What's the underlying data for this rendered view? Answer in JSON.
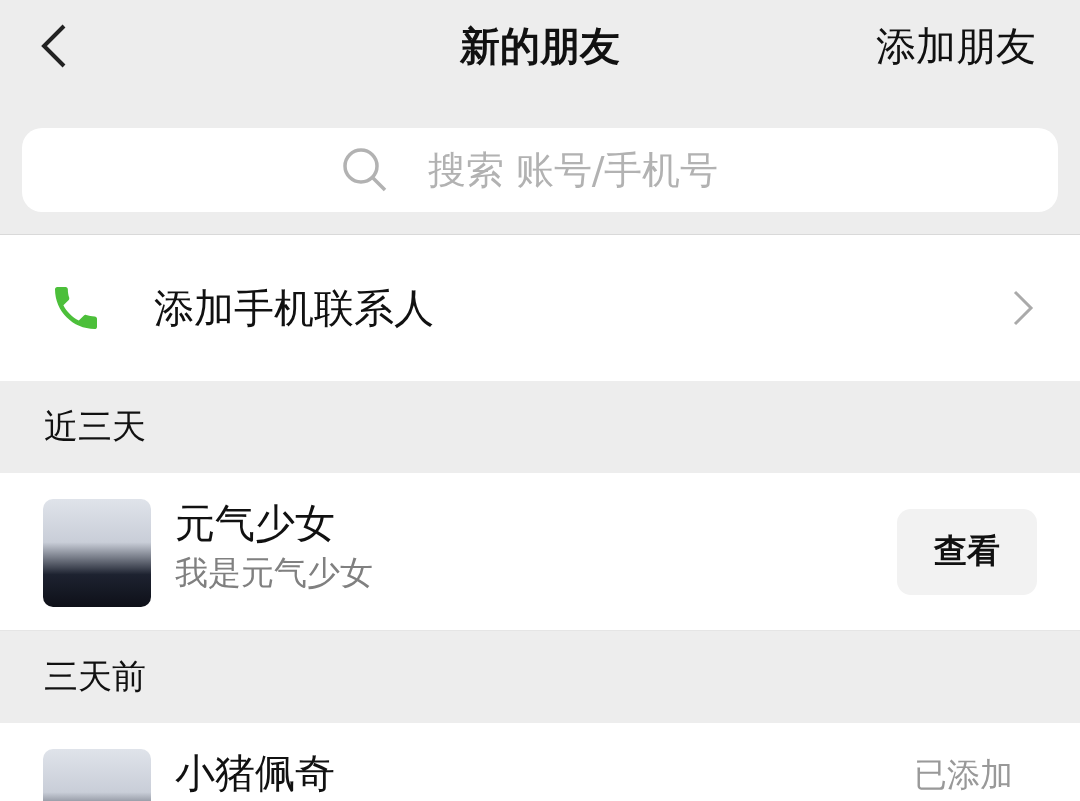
{
  "header": {
    "title": "新的朋友",
    "action": "添加朋友"
  },
  "search": {
    "placeholder": "搜索 账号/手机号"
  },
  "add_contacts": {
    "label": "添加手机联系人"
  },
  "sections": [
    {
      "title": "近三天",
      "requests": [
        {
          "name": "元气少女",
          "message": "我是元气少女",
          "status": "查看",
          "kind": "button"
        }
      ]
    },
    {
      "title": "三天前",
      "requests": [
        {
          "name": "小猪佩奇",
          "status": "已添加",
          "kind": "added"
        }
      ]
    }
  ]
}
